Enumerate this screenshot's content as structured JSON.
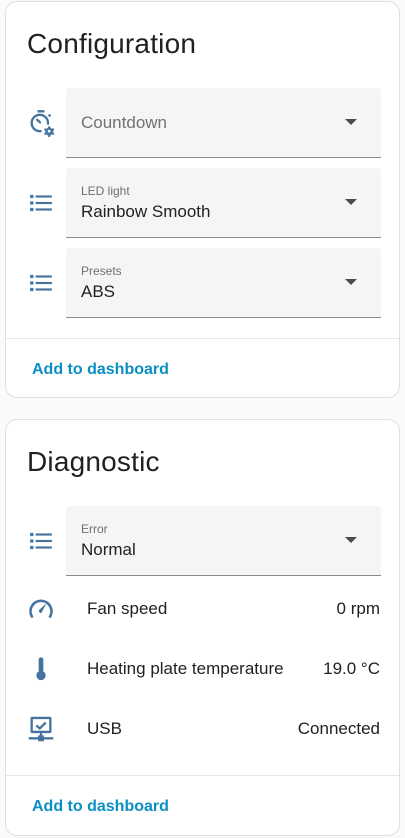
{
  "configuration": {
    "title": "Configuration",
    "countdown": {
      "placeholder": "Countdown",
      "icon": "timer-cog-icon"
    },
    "led_light": {
      "label": "LED light",
      "value": "Rainbow Smooth",
      "icon": "list-icon"
    },
    "presets": {
      "label": "Presets",
      "value": "ABS",
      "icon": "list-icon"
    },
    "add_to_dashboard": "Add to dashboard"
  },
  "diagnostic": {
    "title": "Diagnostic",
    "error": {
      "label": "Error",
      "value": "Normal",
      "icon": "list-icon"
    },
    "sensors": [
      {
        "name": "Fan speed",
        "value": "0 rpm",
        "icon": "speedometer-icon"
      },
      {
        "name": "Heating plate temperature",
        "value": "19.0 °C",
        "icon": "thermometer-icon"
      },
      {
        "name": "USB",
        "value": "Connected",
        "icon": "monitor-network-icon"
      }
    ],
    "add_to_dashboard": "Add to dashboard"
  },
  "colors": {
    "icon": "#44739e",
    "link": "#0a8fc4",
    "field_bg": "#f5f5f5"
  }
}
